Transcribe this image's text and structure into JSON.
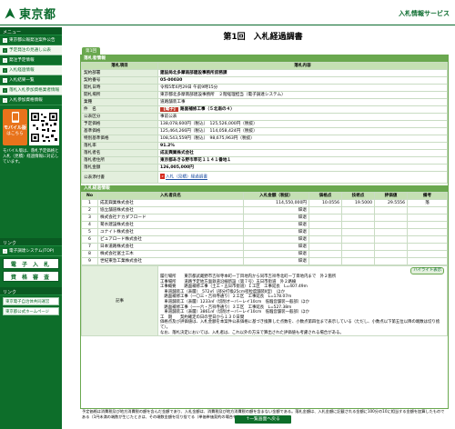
{
  "header": {
    "logo_text": "東京都",
    "service_name": "入札情報サービス"
  },
  "sidebar": {
    "menu_title": "メニュー",
    "items": [
      {
        "label": "東京都公報発注案件公告"
      },
      {
        "label": "予定発注の見通し公表"
      },
      {
        "label": "発注予定情報"
      },
      {
        "label": "入札経過情報"
      },
      {
        "label": "入札結果一覧"
      },
      {
        "label": "落札入札参加資格業者情報"
      },
      {
        "label": "入札参加資格情報"
      }
    ],
    "mobile_badge": {
      "line1": "モバイル版",
      "line2": "はこちら"
    },
    "mobile_note": "モバイル版は、落札予定価格と入札（見積）経過情報に対応しています。",
    "bottom_head": "リンク",
    "bottom_items": [
      {
        "label": "電子調達システム(TOP)"
      },
      {
        "label": "電 子 入 札"
      },
      {
        "label": "資 格 審 査"
      }
    ],
    "sub_head": "リンク",
    "links": [
      {
        "label": "東京電子自治体共同運営"
      },
      {
        "label": "東京都公式ホームページ"
      }
    ]
  },
  "main": {
    "title": "第1回　入札経過調書",
    "round_badge": "第1回",
    "award_section_title": "落札者情報",
    "award_header": {
      "item": "落札項目",
      "content": "落札内容"
    },
    "award_rows": [
      {
        "label": "契約部署",
        "value": "建設局北多摩南部建設事務所庶務課"
      },
      {
        "label": "契約番号",
        "value": "05-00030"
      },
      {
        "label": "開札日時",
        "value": "令和5年6月29日 午前9時15分"
      },
      {
        "label": "開札場所",
        "value": "東京都北多摩南部建設事務所　２階経理担当（電子調達システム）"
      },
      {
        "label": "業種",
        "value": "道路舗装工事"
      },
      {
        "label": "件　名",
        "tag": "【電子】",
        "value": "路面補修工事（５北南の４）"
      },
      {
        "label": "公表区分",
        "value": "事前公表"
      },
      {
        "label": "予定価格",
        "value": "138,078,600円（税込）　125,526,000円（税抜）"
      },
      {
        "label": "基準価格",
        "value": "125,464,266円（税込）　114,058,424円（税抜）"
      },
      {
        "label": "特別基準価格",
        "value": "108,543,559円（税込）　98,675,963円（税抜）"
      },
      {
        "label": "落札率",
        "value": "91.2%"
      },
      {
        "label": "落札者名",
        "value": "成友興業株式会社"
      },
      {
        "label": "落札者住所",
        "value": "東京都あきる野市草花１１４１番地１"
      },
      {
        "label": "落札金額",
        "value": "126,005,000円"
      },
      {
        "label": "公表添付書",
        "value": "入札（見積）経過調書"
      }
    ],
    "bidders_section_title": "入札経過情報",
    "bidders_header": [
      "No",
      "入札者氏名",
      "入札金額（税抜）",
      "価格点",
      "技術点",
      "評価値",
      "備考"
    ],
    "bidders": [
      {
        "no": "1",
        "name": "成友興業株式会社",
        "amount": "114,550,000円",
        "price_pt": "10.0556",
        "tech_pt": "19.5000",
        "eval": "29.5556",
        "note": "落"
      },
      {
        "no": "2",
        "name": "協立舗道株式会社",
        "amount": "辞退",
        "price_pt": "",
        "tech_pt": "",
        "eval": "",
        "note": ""
      },
      {
        "no": "3",
        "name": "株式会社ナカダフロード",
        "amount": "辞退",
        "price_pt": "",
        "tech_pt": "",
        "eval": "",
        "note": ""
      },
      {
        "no": "4",
        "name": "菊水建設株式会社",
        "amount": "辞退",
        "price_pt": "",
        "tech_pt": "",
        "eval": "",
        "note": ""
      },
      {
        "no": "5",
        "name": "ユナイト株式会社",
        "amount": "辞退",
        "price_pt": "",
        "tech_pt": "",
        "eval": "",
        "note": ""
      },
      {
        "no": "6",
        "name": "ピュアロード株式会社",
        "amount": "辞退",
        "price_pt": "",
        "tech_pt": "",
        "eval": "",
        "note": ""
      },
      {
        "no": "7",
        "name": "日本道路株式会社",
        "amount": "辞退",
        "price_pt": "",
        "tech_pt": "",
        "eval": "",
        "note": ""
      },
      {
        "no": "8",
        "name": "株式会社富士工木",
        "amount": "辞退",
        "price_pt": "",
        "tech_pt": "",
        "eval": "",
        "note": ""
      },
      {
        "no": "9",
        "name": "世紀東急工業株式会社",
        "amount": "辞退",
        "price_pt": "",
        "tech_pt": "",
        "eval": "",
        "note": ""
      }
    ],
    "highlight_link": "ハイライト表示",
    "remarks_label": "記事",
    "remarks_lines": [
      "履行場所　　東京都武蔵野市吉祥寺本町一丁目地内から同市吉祥寺北町一丁目地内まで　外２箇所",
      "工事場所　　道路予定地方面鉄道沿線新設（第７号）五日市街道　外２路線",
      "工事概要　　路面補修工事（土工・五日市街道）Ｉ工区　工事延長　L=407.49m",
      "　車道舗装工（表層）　572㎡（部分打換25cm密粒度舗装Ⅱ型）　ほか",
      "　路面補修工事（一〇三・吉祥寺通り）２工区　工事延長　L=178.07m",
      "　車道舗装工（表層）1233㎡（切削オーバーレイ10cm　低騒音舗装一般部）ほか",
      "　路面補修工事（一一六・吉祥寺通り）３工区　工事延長　L=527.38m",
      "　車道舗装工（表層）3861㎡（切削オーバーレイ10cm　低騒音舗装一般部）ほか",
      "工　期　　契約確定の日の翌日から１３０日間",
      "価格点及び評価値は、入札金額を本案件公表価格に基づき換算した点数を、小数点第四位まで表示している（ただし、小数点以下第五位以降の端数は切り捨て）。",
      "なお、落札決定においては、入札者は、これ以外の方法で算出された評価値も考慮される場合がある。"
    ],
    "footnote": "予定価格は消費税及び地方消費税の額を含んだ金額であり、入札金額は、消費税及び地方消費税の額を含まない金額である。落札金額は、入札金額に記載される金額に100分の10に相当する金額を加算したものである（1円未満の端数が生じたときは、その端数金額を切り捨てる（単価単価契約の場合を除く））。",
    "back_button": "↑一覧画面へ戻る"
  }
}
